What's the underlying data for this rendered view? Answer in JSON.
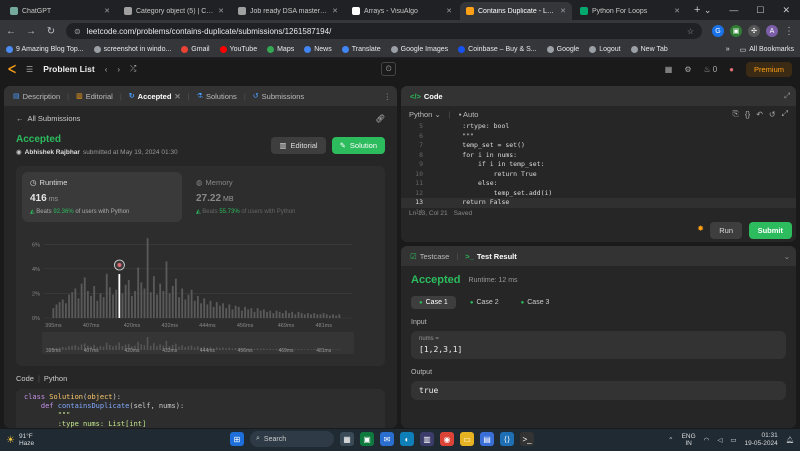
{
  "browser": {
    "tabs": [
      {
        "label": "ChatGPT",
        "color": "#74aa9c",
        "active": false
      },
      {
        "label": "Category object (5) | Chang",
        "color": "#a0a0a0",
        "active": false
      },
      {
        "label": "Job ready DSA mastery co",
        "color": "#a0a0a0",
        "active": false
      },
      {
        "label": "Arrays - VisuAlgo",
        "color": "#ffffff",
        "active": false
      },
      {
        "label": "Contains Duplicate - Leet",
        "color": "#ffa116",
        "active": true
      },
      {
        "label": "Python For Loops",
        "color": "#04aa6d",
        "active": false
      }
    ],
    "new_tab": "+",
    "url": "leetcode.com/problems/contains-duplicate/submissions/1261587194/",
    "bookmarks": [
      {
        "label": "9 Amazing Blog Top...",
        "color": "#4c8bf5"
      },
      {
        "label": "screenshot in windo...",
        "color": "#9aa0a6"
      },
      {
        "label": "Gmail",
        "color": "#ea4335"
      },
      {
        "label": "YouTube",
        "color": "#ff0000"
      },
      {
        "label": "Maps",
        "color": "#34a853"
      },
      {
        "label": "News",
        "color": "#4285f4"
      },
      {
        "label": "Translate",
        "color": "#4285f4"
      },
      {
        "label": "Google Images",
        "color": "#9aa0a6"
      },
      {
        "label": "Coinbase – Buy & S...",
        "color": "#1652f0"
      },
      {
        "label": "Google",
        "color": "#9aa0a6"
      },
      {
        "label": "Logout",
        "color": "#9aa0a6"
      },
      {
        "label": "New Tab",
        "color": "#9aa0a6"
      }
    ],
    "all_bookmarks": "All Bookmarks"
  },
  "lc": {
    "nav_title": "Problem List",
    "fire_count": "0",
    "premium": "Premium",
    "left_tabs": [
      "Description",
      "Editorial",
      "Accepted",
      "Solutions",
      "Submissions"
    ],
    "all_submissions": "All Submissions",
    "status": "Accepted",
    "author": "Abhishek Rajbhar",
    "submitted_at": "submitted at May 19, 2024 01:30",
    "editorial_btn": "Editorial",
    "solution_btn": "Solution",
    "runtime_label": "Runtime",
    "runtime_value": "416",
    "runtime_unit": "ms",
    "runtime_beats_pre": "Beats",
    "runtime_beats_pct": "92.36%",
    "runtime_beats_post": "of users with Python",
    "memory_label": "Memory",
    "memory_value": "27.22",
    "memory_unit": "MB",
    "memory_beats_pre": "Beats",
    "memory_beats_pct": "55.73%",
    "memory_beats_post": "of users with Python",
    "code_label": "Code",
    "code_lang": "Python",
    "code_preview": [
      "class Solution(object):",
      "    def containsDuplicate(self, nums):",
      "        \"\"\"",
      "        :type nums: List[int]"
    ]
  },
  "editor": {
    "title": "Code",
    "lang": "Python",
    "mode": "Auto",
    "lines": [
      {
        "n": "5",
        "text": "        :rtype: bool"
      },
      {
        "n": "6",
        "text": "        \"\"\""
      },
      {
        "n": "7",
        "text": "        temp_set = set()"
      },
      {
        "n": "8",
        "text": "        for i in nums:"
      },
      {
        "n": "9",
        "text": "            if i in temp_set:"
      },
      {
        "n": "10",
        "text": "                return True"
      },
      {
        "n": "11",
        "text": "            else:"
      },
      {
        "n": "12",
        "text": "                temp_set.add(i)"
      },
      {
        "n": "13",
        "text": "        return False"
      },
      {
        "n": "14",
        "text": ""
      }
    ],
    "current_line": "13",
    "cursor": "Ln 13, Col 21",
    "saved": "Saved",
    "run": "Run",
    "submit": "Submit"
  },
  "test": {
    "tab_testcase": "Testcase",
    "tab_result": "Test Result",
    "status": "Accepted",
    "runtime": "Runtime: 12 ms",
    "cases": [
      "Case 1",
      "Case 2",
      "Case 3"
    ],
    "input_label": "Input",
    "var_name": "nums =",
    "var_value": "[1,2,3,1]",
    "output_label": "Output",
    "output_value": "true"
  },
  "taskbar": {
    "temp": "91°F",
    "weather": "Haze",
    "search": "Search",
    "lang1": "ENG",
    "lang2": "IN",
    "time": "01:31",
    "date": "19-05-2024"
  },
  "chart_data": {
    "type": "bar",
    "title": "",
    "y_ticks": [
      "6%",
      "4%",
      "2%",
      "0%"
    ],
    "ylim": [
      0,
      7
    ],
    "x_ticks": [
      "395ms",
      "407ms",
      "420ms",
      "432ms",
      "444ms",
      "456ms",
      "469ms",
      "481ms"
    ],
    "xlim": [
      392,
      490
    ],
    "highlight_x": 416,
    "bars": [
      {
        "x": 395,
        "y": 0.8
      },
      {
        "x": 396,
        "y": 1.1
      },
      {
        "x": 397,
        "y": 1.3
      },
      {
        "x": 398,
        "y": 1.5
      },
      {
        "x": 399,
        "y": 1.2
      },
      {
        "x": 400,
        "y": 1.9
      },
      {
        "x": 401,
        "y": 2.1
      },
      {
        "x": 402,
        "y": 2.4
      },
      {
        "x": 403,
        "y": 1.6
      },
      {
        "x": 404,
        "y": 2.8
      },
      {
        "x": 405,
        "y": 3.3
      },
      {
        "x": 406,
        "y": 2.2
      },
      {
        "x": 407,
        "y": 1.8
      },
      {
        "x": 408,
        "y": 2.6
      },
      {
        "x": 409,
        "y": 1.4
      },
      {
        "x": 410,
        "y": 2.0
      },
      {
        "x": 411,
        "y": 1.7
      },
      {
        "x": 412,
        "y": 3.6
      },
      {
        "x": 413,
        "y": 2.5
      },
      {
        "x": 414,
        "y": 1.9
      },
      {
        "x": 415,
        "y": 2.3
      },
      {
        "x": 416,
        "y": 3.8
      },
      {
        "x": 417,
        "y": 2.0
      },
      {
        "x": 418,
        "y": 2.7
      },
      {
        "x": 419,
        "y": 3.1
      },
      {
        "x": 420,
        "y": 1.8
      },
      {
        "x": 421,
        "y": 2.2
      },
      {
        "x": 422,
        "y": 4.1
      },
      {
        "x": 423,
        "y": 2.9
      },
      {
        "x": 424,
        "y": 2.4
      },
      {
        "x": 425,
        "y": 6.5
      },
      {
        "x": 426,
        "y": 2.1
      },
      {
        "x": 427,
        "y": 3.4
      },
      {
        "x": 428,
        "y": 1.9
      },
      {
        "x": 429,
        "y": 2.8
      },
      {
        "x": 430,
        "y": 2.2
      },
      {
        "x": 431,
        "y": 4.6
      },
      {
        "x": 432,
        "y": 2.0
      },
      {
        "x": 433,
        "y": 2.6
      },
      {
        "x": 434,
        "y": 3.2
      },
      {
        "x": 435,
        "y": 1.7
      },
      {
        "x": 436,
        "y": 2.4
      },
      {
        "x": 437,
        "y": 1.5
      },
      {
        "x": 438,
        "y": 1.9
      },
      {
        "x": 439,
        "y": 2.3
      },
      {
        "x": 440,
        "y": 1.4
      },
      {
        "x": 441,
        "y": 1.8
      },
      {
        "x": 442,
        "y": 1.2
      },
      {
        "x": 443,
        "y": 1.6
      },
      {
        "x": 444,
        "y": 1.1
      },
      {
        "x": 445,
        "y": 1.4
      },
      {
        "x": 446,
        "y": 0.9
      },
      {
        "x": 447,
        "y": 1.3
      },
      {
        "x": 448,
        "y": 1.0
      },
      {
        "x": 449,
        "y": 1.2
      },
      {
        "x": 450,
        "y": 0.8
      },
      {
        "x": 451,
        "y": 1.1
      },
      {
        "x": 452,
        "y": 0.7
      },
      {
        "x": 453,
        "y": 1.0
      },
      {
        "x": 454,
        "y": 0.9
      },
      {
        "x": 455,
        "y": 0.6
      },
      {
        "x": 456,
        "y": 0.9
      },
      {
        "x": 457,
        "y": 0.7
      },
      {
        "x": 458,
        "y": 0.8
      },
      {
        "x": 459,
        "y": 0.5
      },
      {
        "x": 460,
        "y": 0.8
      },
      {
        "x": 461,
        "y": 0.6
      },
      {
        "x": 462,
        "y": 0.7
      },
      {
        "x": 463,
        "y": 0.5
      },
      {
        "x": 464,
        "y": 0.6
      },
      {
        "x": 465,
        "y": 0.4
      },
      {
        "x": 466,
        "y": 0.6
      },
      {
        "x": 467,
        "y": 0.5
      },
      {
        "x": 468,
        "y": 0.4
      },
      {
        "x": 469,
        "y": 0.6
      },
      {
        "x": 470,
        "y": 0.4
      },
      {
        "x": 471,
        "y": 0.5
      },
      {
        "x": 472,
        "y": 0.3
      },
      {
        "x": 473,
        "y": 0.5
      },
      {
        "x": 474,
        "y": 0.4
      },
      {
        "x": 475,
        "y": 0.3
      },
      {
        "x": 476,
        "y": 0.4
      },
      {
        "x": 477,
        "y": 0.3
      },
      {
        "x": 478,
        "y": 0.4
      },
      {
        "x": 479,
        "y": 0.3
      },
      {
        "x": 480,
        "y": 0.3
      },
      {
        "x": 481,
        "y": 0.4
      },
      {
        "x": 482,
        "y": 0.3
      },
      {
        "x": 483,
        "y": 0.2
      },
      {
        "x": 484,
        "y": 0.3
      },
      {
        "x": 485,
        "y": 0.2
      },
      {
        "x": 486,
        "y": 0.3
      }
    ]
  }
}
